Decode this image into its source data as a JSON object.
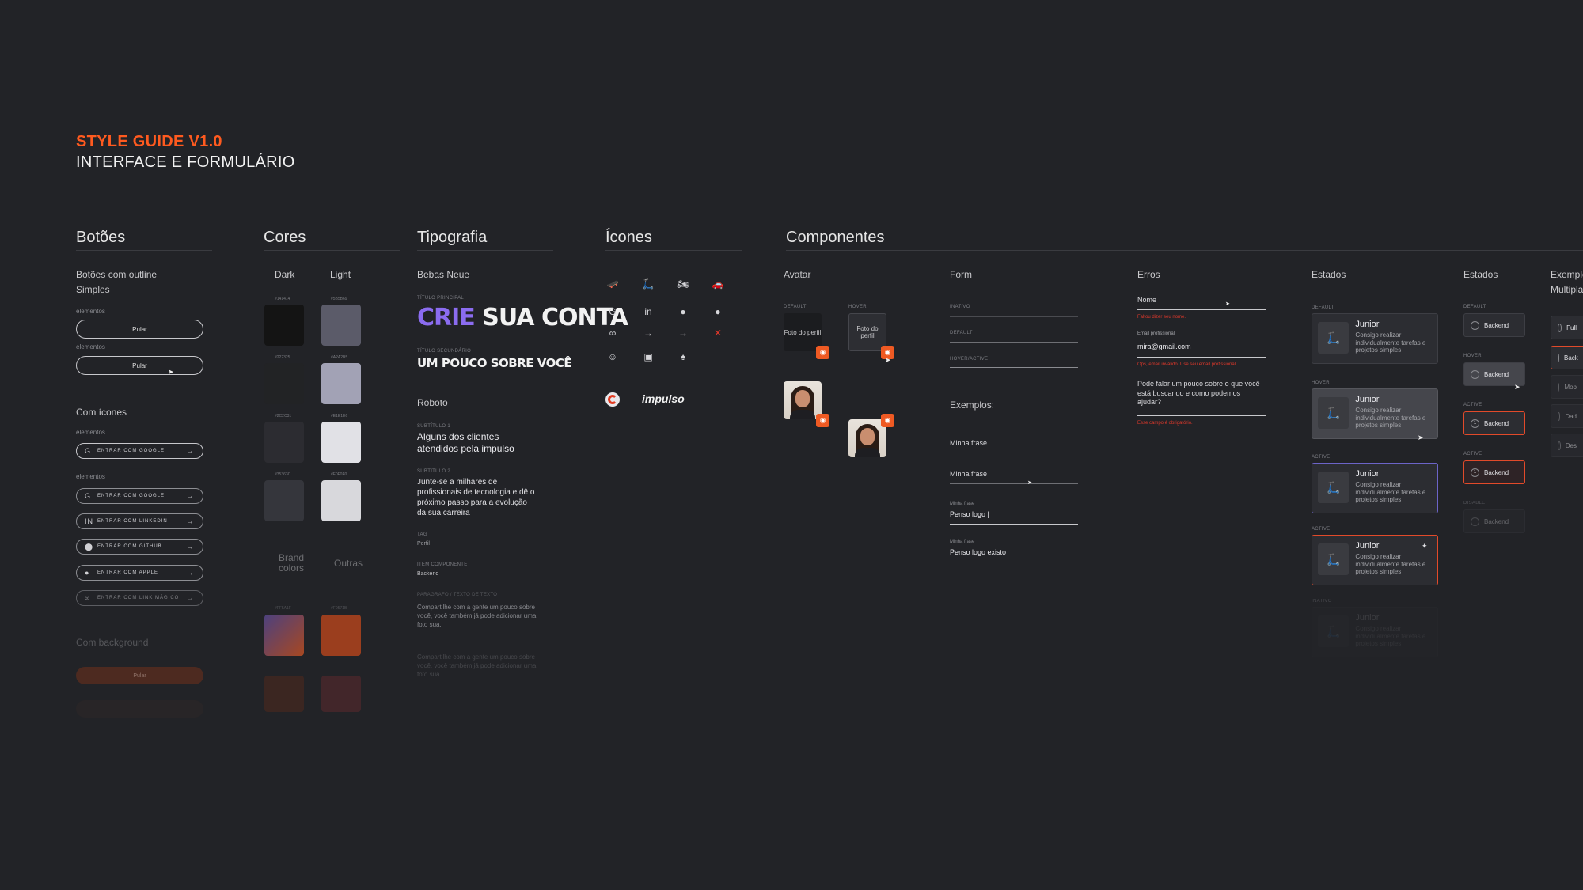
{
  "header": {
    "title": "STYLE GUIDE V1.0",
    "subtitle": "INTERFACE E FORMULÁRIO"
  },
  "sections": {
    "botoes": "Botões",
    "cores": "Cores",
    "tipografia": "Tipografia",
    "icones": "Ícones",
    "componentes": "Componentes"
  },
  "botoes": {
    "outline_label": "Botões com outline",
    "simples_label": "Simples",
    "elementos": "elementos",
    "pular": "Pular",
    "com_icones_label": "Com ícones",
    "social": [
      {
        "icon": "google-icon",
        "glyph": "G",
        "label": "ENTRAR COM GOOGLE"
      },
      {
        "icon": "google-icon",
        "glyph": "G",
        "label": "ENTRAR COM GOOGLE"
      },
      {
        "icon": "linkedin-icon",
        "glyph": "in",
        "label": "ENTRAR COM LINKEDIN"
      },
      {
        "icon": "github-icon",
        "glyph": "⬤",
        "label": "ENTRAR COM GITHUB"
      },
      {
        "icon": "apple-icon",
        "glyph": "●",
        "label": "ENTRAR COM APPLE"
      },
      {
        "icon": "link-icon",
        "glyph": "∞",
        "label": "ENTRAR COM LINK MÁGICO"
      }
    ],
    "com_background_label": "Com background",
    "bg_button": "Pular"
  },
  "cores": {
    "dark_label": "Dark",
    "light_label": "Light",
    "dark": [
      {
        "hex": "#141414",
        "color": "#141414"
      },
      {
        "hex": "#222325",
        "color": "#222325"
      },
      {
        "hex": "#2C2C31",
        "color": "#2C2C31"
      },
      {
        "hex": "#35363C",
        "color": "#35363C"
      }
    ],
    "light": [
      {
        "hex": "#5B5B69",
        "color": "#5B5B69"
      },
      {
        "hex": "#A2A2B5",
        "color": "#A2A2B5"
      },
      {
        "hex": "#E1E1E6",
        "color": "#E1E1E6"
      },
      {
        "hex": "#F0F0F0",
        "color": "#D8D8DC"
      }
    ],
    "brand_label": "Brand colors",
    "outras_label": "Outras",
    "brand_hex": "#FF5A1F",
    "outras_hex": "#F0571B"
  },
  "tipografia": {
    "bebas_label": "Bebas Neue",
    "titulo_principal_tag": "TÍTULO PRINCIPAL",
    "crie": "CRIE",
    "sua_conta": "SUA CONTA",
    "titulo_secundario_tag": "TÍTULO SECUNDÁRIO",
    "um_pouco": "UM POUCO SOBRE VOCÊ",
    "roboto_label": "Roboto",
    "subtitulo1_tag": "SUBTÍTULO 1",
    "subtitulo1": "Alguns dos clientes atendidos pela impulso",
    "subtitulo2_tag": "SUBTÍTULO 2",
    "subtitulo2": "Junte-se a milhares de profissionais de tecnologia e dê o próximo passo para a evolução da sua carreira",
    "tag_tag": "TAG",
    "tag": "Perfil",
    "item_tag": "ITEM COMPONENTE",
    "item": "Backend",
    "paragrafo_tag": "PARÁGRAFO / TEXTO DE TEXTO",
    "paragrafo": "Compartilhe com a gente um pouco sobre você, você também já pode adicionar uma foto sua.",
    "paragrafo2": "Compartilhe com a gente um pouco sobre você, você também já pode adicionar uma foto sua."
  },
  "icones": {
    "rows": [
      [
        "skateboard-icon",
        "scooter-icon",
        "motorcycle-icon",
        "car-icon"
      ],
      [
        "google-icon",
        "linkedin-icon",
        "github-icon",
        "apple-icon"
      ],
      [
        "link-icon",
        "arrow-right-icon",
        "arrow-right-icon",
        "close-icon"
      ],
      [
        "avatar-edit-icon",
        "briefcase-icon",
        "rocket-icon"
      ]
    ],
    "glyphs": [
      [
        "🛹",
        "🛴",
        "🏍",
        "🚗"
      ],
      [
        "G",
        "in",
        "●",
        "●"
      ],
      [
        "∞",
        "→",
        "→",
        "✕"
      ],
      [
        "☺",
        "▣",
        "♠"
      ]
    ],
    "brand_name": "impulso"
  },
  "componentes": {
    "avatar": {
      "label": "Avatar",
      "default_tag": "DEFAULT",
      "hover_tag": "HOVER",
      "foto_label": "Foto do perfil"
    },
    "form": {
      "label": "Form",
      "inativo_tag": "INATIVO",
      "default_tag": "DEFAULT",
      "hover_tag": "HOVER/ACTIVE",
      "exemplos": "Exemplos:",
      "minha_frase": "Minha frase",
      "minha_frase2": "Minha frase",
      "small_label": "Minha frase",
      "penso": "Penso logo |",
      "small_label2": "Minha frase",
      "penso2": "Penso logo existo"
    },
    "erros": {
      "label": "Erros",
      "nome": "Nome",
      "nome_err": "Faltou dizer seu nome.",
      "email_label": "Email profissional",
      "email_value": "mira@gmail.com",
      "email_err": "Ops, email inválido. Use seu email profissional.",
      "pode": "Pode falar um pouco sobre o que você está buscando e como podemos ajudar?",
      "campo_err": "Esse campo é obrigatório."
    },
    "estados": {
      "label": "Estados",
      "tags": [
        "DEFAULT",
        "HOVER",
        "ACTIVE",
        "ACTIVE",
        "INATIVO"
      ],
      "card_title": "Junior",
      "card_desc": "Consigo realizar individualmente tarefas e projetos simples"
    },
    "estados2": {
      "label": "Estados",
      "tags": [
        "DEFAULT",
        "HOVER",
        "ACTIVE",
        "ACTIVE",
        "DISABLE"
      ],
      "chip": "Backend"
    },
    "exemplo": {
      "label": "Exemplo",
      "multiplo": "Multipla",
      "chips": [
        "Full",
        "Back",
        "Mob",
        "Dad",
        "Des"
      ]
    }
  },
  "colors": {
    "accent": "#FF5A1F",
    "background": "#222327",
    "error": "#E0382B",
    "active_border": "#E24A2A"
  }
}
